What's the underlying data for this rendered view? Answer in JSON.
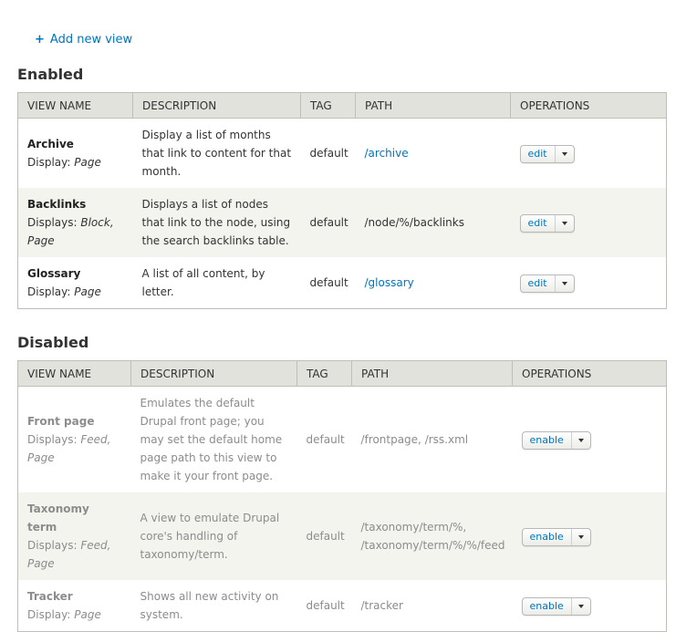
{
  "add_link": {
    "plus": "+",
    "label": "Add new view"
  },
  "enabled": {
    "heading": "Enabled",
    "columns": [
      "VIEW NAME",
      "DESCRIPTION",
      "TAG",
      "PATH",
      "OPERATIONS"
    ],
    "rows": [
      {
        "name": "Archive",
        "display_label": "Display:",
        "display_value": "Page",
        "description": "Display a list of months that link to content for that month.",
        "tag": "default",
        "path": "/archive",
        "path_is_link": true,
        "op": "edit"
      },
      {
        "name": "Backlinks",
        "display_label": "Displays:",
        "display_value": "Block, Page",
        "description": "Displays a list of nodes that link to the node, using the search backlinks table.",
        "tag": "default",
        "path": "/node/%/backlinks",
        "path_is_link": false,
        "op": "edit"
      },
      {
        "name": "Glossary",
        "display_label": "Display:",
        "display_value": "Page",
        "description": "A list of all content, by letter.",
        "tag": "default",
        "path": "/glossary",
        "path_is_link": true,
        "op": "edit"
      }
    ]
  },
  "disabled": {
    "heading": "Disabled",
    "columns": [
      "VIEW NAME",
      "DESCRIPTION",
      "TAG",
      "PATH",
      "OPERATIONS"
    ],
    "rows": [
      {
        "name": "Front page",
        "display_label": "Displays:",
        "display_value": "Feed, Page",
        "description": "Emulates the default Drupal front page; you may set the default home page path to this view to make it your front page.",
        "tag": "default",
        "path": "/frontpage, /rss.xml",
        "path_is_link": false,
        "op": "enable"
      },
      {
        "name": "Taxonomy term",
        "display_label": "Displays:",
        "display_value": "Feed, Page",
        "description": "A view to emulate Drupal core's handling of taxonomy/term.",
        "tag": "default",
        "path": "/taxonomy/term/%, /taxonomy/term/%/%/feed",
        "path_is_link": false,
        "op": "enable"
      },
      {
        "name": "Tracker",
        "display_label": "Display:",
        "display_value": "Page",
        "description": "Shows all new activity on system.",
        "tag": "default",
        "path": "/tracker",
        "path_is_link": false,
        "op": "enable"
      }
    ]
  },
  "icons": {
    "add": "plus-icon",
    "dropdown": "caret-down-icon"
  },
  "colors": {
    "link": "#0074bd",
    "header_bg": "#e1e2dc",
    "even_row_bg": "#f3f4ee",
    "disabled_text": "#8c8c8c"
  }
}
